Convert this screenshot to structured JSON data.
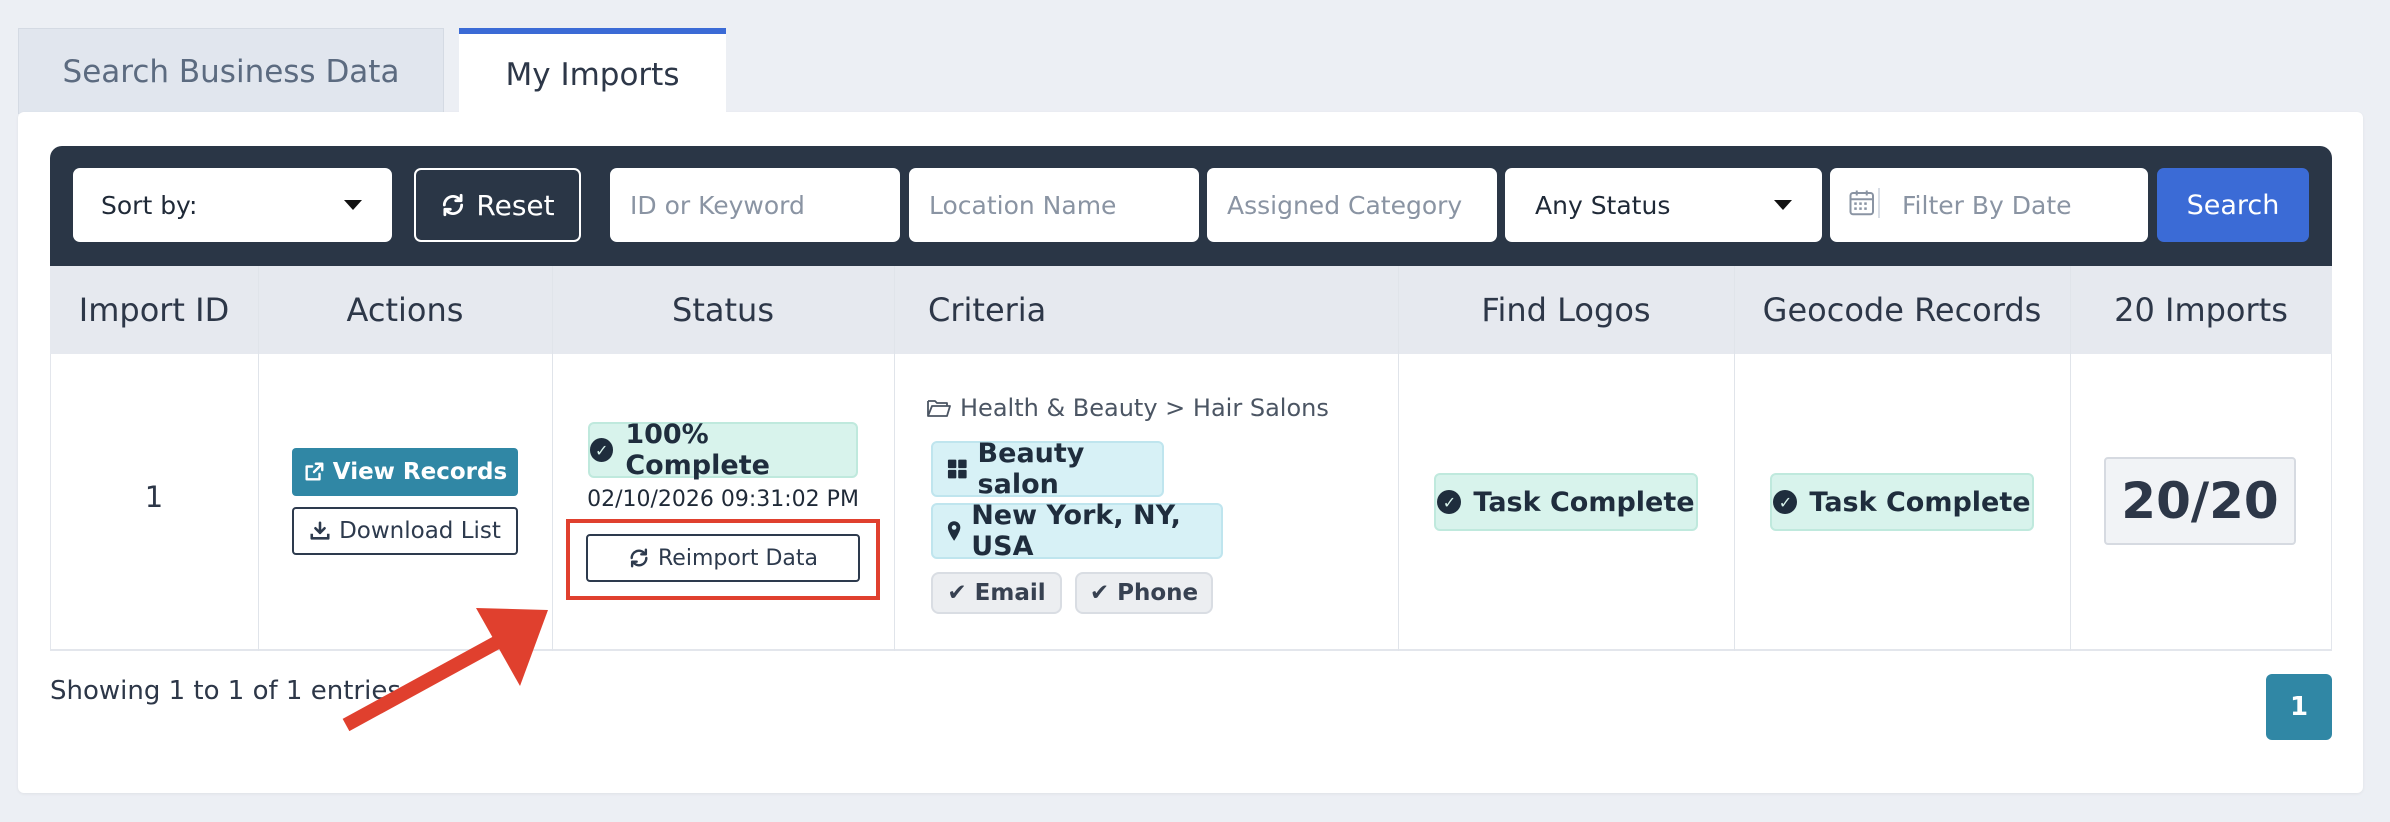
{
  "tabs": [
    {
      "label": "Search Business Data",
      "active": false
    },
    {
      "label": "My Imports",
      "active": true
    }
  ],
  "toolbar": {
    "sort_label": "Sort by:",
    "reset_label": "Reset",
    "id_placeholder": "ID or Keyword",
    "location_placeholder": "Location Name",
    "category_placeholder": "Assigned Category",
    "status_label": "Any Status",
    "date_placeholder": "Filter By Date",
    "search_label": "Search"
  },
  "columns": [
    "Import ID",
    "Actions",
    "Status",
    "Criteria",
    "Find Logos",
    "Geocode Records",
    "20 Imports"
  ],
  "row": {
    "import_id": "1",
    "view_records": "View Records",
    "download_list": "Download List",
    "status_badge": "100% Complete",
    "status_time": "02/10/2026 09:31:02 PM",
    "reimport": "Reimport Data",
    "criteria_path": "Health & Beauty > Hair Salons",
    "criteria_category": "Beauty salon",
    "criteria_location": "New York, NY, USA",
    "criteria_email": "Email",
    "criteria_phone": "Phone",
    "find_logos": "Task Complete",
    "geocode": "Task Complete",
    "imports_count": "20/20"
  },
  "footer": {
    "entries_text": "Showing 1 to 1 of 1 entries",
    "page": "1"
  },
  "colors": {
    "primary": "#3b6bd6",
    "toolbar_bg": "#2a3646",
    "info": "#3087a5",
    "highlight": "#e0402e"
  }
}
